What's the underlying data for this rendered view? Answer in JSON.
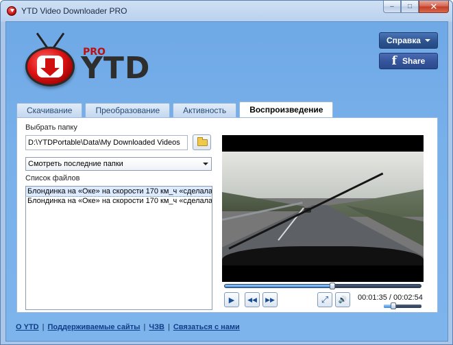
{
  "window": {
    "title": "YTD Video Downloader PRO",
    "buttons": {
      "minimize": "–",
      "maximize": "□",
      "close": "✕"
    }
  },
  "logo": {
    "pro": "PRO",
    "ytd": "YTD"
  },
  "header": {
    "help_label": "Справка",
    "share_label": "Share",
    "share_icon": "f"
  },
  "tabs": [
    {
      "label": "Скачивание",
      "active": false
    },
    {
      "label": "Преобразование",
      "active": false
    },
    {
      "label": "Активность",
      "active": false
    },
    {
      "label": "Воспроизведение",
      "active": true
    }
  ],
  "playback": {
    "folder_label": "Выбрать папку",
    "folder_path": "D:\\YTDPortable\\Data\\My Downloaded Videos",
    "recent_select": "Смотреть последние папки",
    "files_label": "Список файлов",
    "files": [
      {
        "name": "Блондинка на «Оке» на скорости 170 км_ч «сделала",
        "selected": true
      },
      {
        "name": "Блондинка на «Оке» на скорости 170 км_ч «сделала",
        "selected": false
      }
    ]
  },
  "player": {
    "progress_fraction": 0.55,
    "volume_fraction": 0.25,
    "current_time": "00:01:35",
    "total_time": "00:02:54",
    "time_separator": " / ",
    "play_icon": "▶",
    "rewind_icon": "◀◀",
    "forward_icon": "▶▶",
    "fullscreen_icon": "⤢",
    "volume_icon": "🔊"
  },
  "footer": {
    "links": [
      "О YTD",
      "Поддерживаемые сайты",
      "ЧЗВ",
      "Связаться с нами"
    ]
  }
}
